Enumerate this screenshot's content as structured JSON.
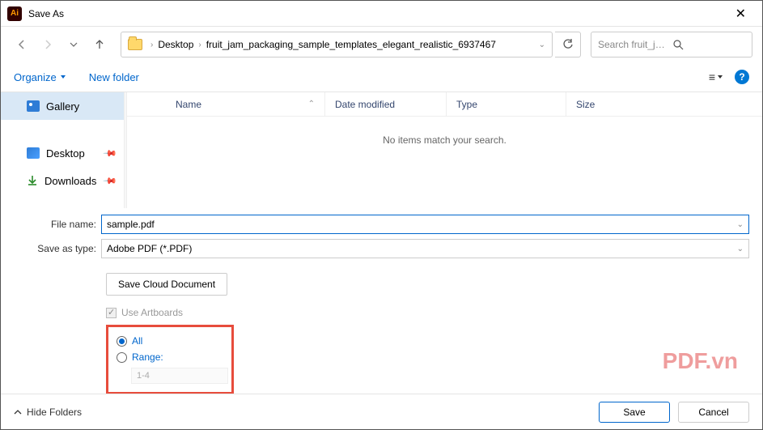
{
  "titlebar": {
    "title": "Save As"
  },
  "nav": {
    "crumbs": [
      "Desktop",
      "fruit_jam_packaging_sample_templates_elegant_realistic_6937467"
    ],
    "search_placeholder": "Search fruit_jam_packaging..."
  },
  "toolbar": {
    "organize": "Organize",
    "new_folder": "New folder"
  },
  "sidebar": {
    "items": [
      {
        "label": "Gallery"
      },
      {
        "label": "Desktop"
      },
      {
        "label": "Downloads"
      }
    ]
  },
  "columns": {
    "name": "Name",
    "date": "Date modified",
    "type": "Type",
    "size": "Size"
  },
  "empty": "No items match your search.",
  "form": {
    "filename_label": "File name:",
    "filename_value": "sample.pdf",
    "type_label": "Save as type:",
    "type_value": "Adobe PDF (*.PDF)"
  },
  "options": {
    "cloud_btn": "Save Cloud Document",
    "use_artboards": "Use Artboards",
    "all": "All",
    "range": "Range:",
    "range_value": "1-4"
  },
  "watermark": "PDF.vn",
  "footer": {
    "hide": "Hide Folders",
    "save": "Save",
    "cancel": "Cancel"
  }
}
